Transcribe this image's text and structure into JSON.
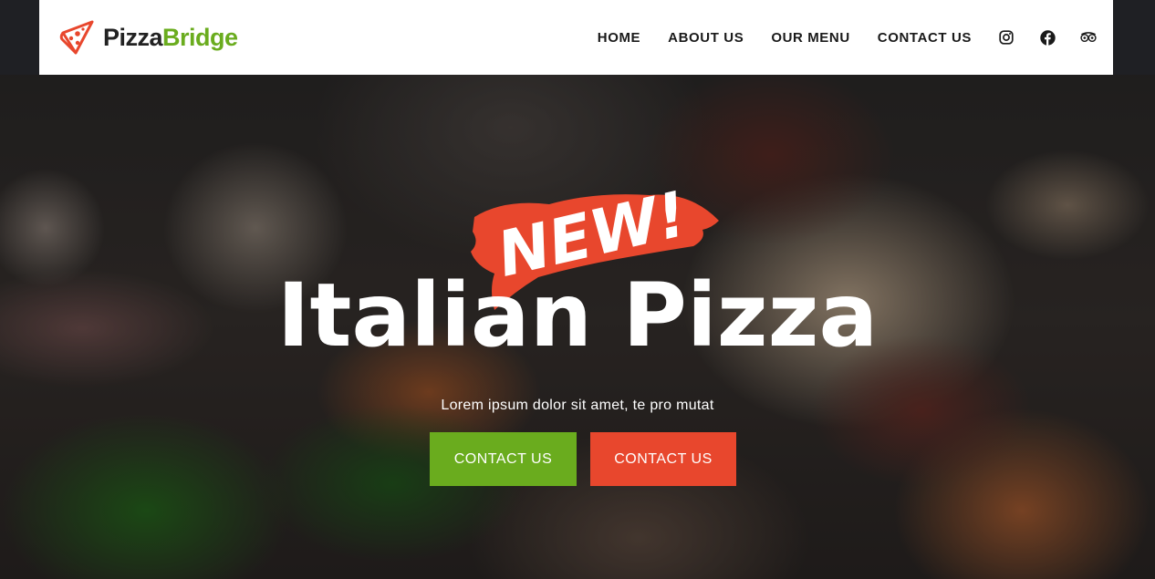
{
  "brand": {
    "name_part1": "Pizza",
    "name_part2": "Bridge",
    "logo_icon": "pizza-slice-icon",
    "colors": {
      "green": "#6aac1e",
      "red": "#e8472d",
      "dark": "#222222"
    }
  },
  "nav": {
    "items": [
      {
        "label": "HOME"
      },
      {
        "label": "ABOUT US"
      },
      {
        "label": "OUR MENU"
      },
      {
        "label": "CONTACT US"
      }
    ],
    "social": [
      {
        "icon": "instagram-icon"
      },
      {
        "icon": "facebook-icon"
      },
      {
        "icon": "tripadvisor-icon"
      }
    ]
  },
  "hero": {
    "badge": "NEW!",
    "title": "Italian Pizza",
    "subtitle": "Lorem ipsum dolor sit amet, te pro mutat",
    "buttons": [
      {
        "label": "CONTACT US",
        "color": "#6aac1e"
      },
      {
        "label": "CONTACT US",
        "color": "#e8472d"
      }
    ]
  }
}
